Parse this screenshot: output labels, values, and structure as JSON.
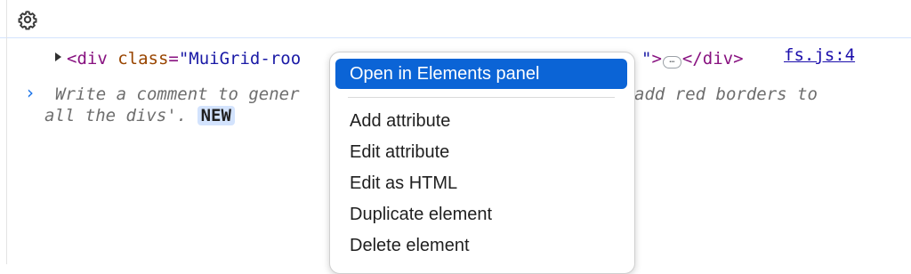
{
  "toolbar": {
    "settings_icon": "gear-icon"
  },
  "console": {
    "element_row": {
      "open": "<div",
      "attr_name": " class",
      "eq": "=",
      "attr_value_visible": "\"MuiGrid-roo",
      "attr_value_tail": "\"",
      "close_open": ">",
      "ellipsis": "…",
      "close_tag": "</div>"
    },
    "source_link": "fs.js:4",
    "prompt": {
      "arrow": "›",
      "line1_start": "Write a comment to gener",
      "line1_end": "add red borders to",
      "line2": "all the divs'. ",
      "badge": "NEW"
    }
  },
  "context_menu": {
    "items": [
      {
        "label": "Open in Elements panel",
        "selected": true
      },
      {
        "label": "Add attribute"
      },
      {
        "label": "Edit attribute"
      },
      {
        "label": "Edit as HTML"
      },
      {
        "label": "Duplicate element"
      },
      {
        "label": "Delete element"
      }
    ]
  },
  "colors": {
    "selection": "#0b64d6",
    "link": "#1a0dab",
    "tag": "#881280",
    "attr_name": "#994500",
    "attr_value": "#1a1aa6",
    "prompt_arrow": "#1a73e8",
    "badge_bg": "#d3e3fd"
  }
}
